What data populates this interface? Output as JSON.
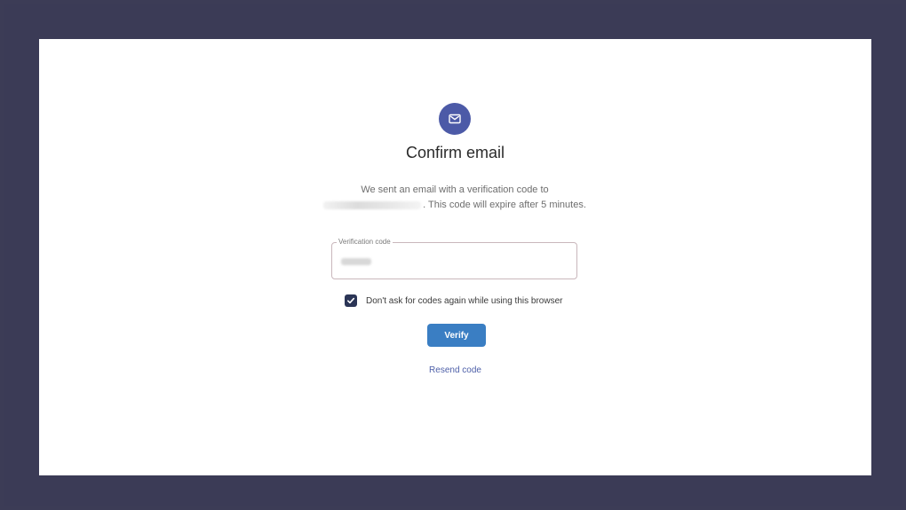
{
  "title": "Confirm email",
  "message": {
    "line1": "We sent an email with a verification code to",
    "line2": ". This code will expire after 5 minutes."
  },
  "verification_field": {
    "label": "Verification code",
    "value": ""
  },
  "remember_device": {
    "label": "Don't ask for codes again while using this browser",
    "checked": true
  },
  "actions": {
    "verify_label": "Verify",
    "resend_label": "Resend code"
  },
  "colors": {
    "background": "#3b3b56",
    "accent": "#4c5aa7",
    "button": "#3a7ec3",
    "link": "#4d5fa8"
  },
  "icons": {
    "badge": "mail-icon",
    "checkbox": "checkmark-icon"
  }
}
